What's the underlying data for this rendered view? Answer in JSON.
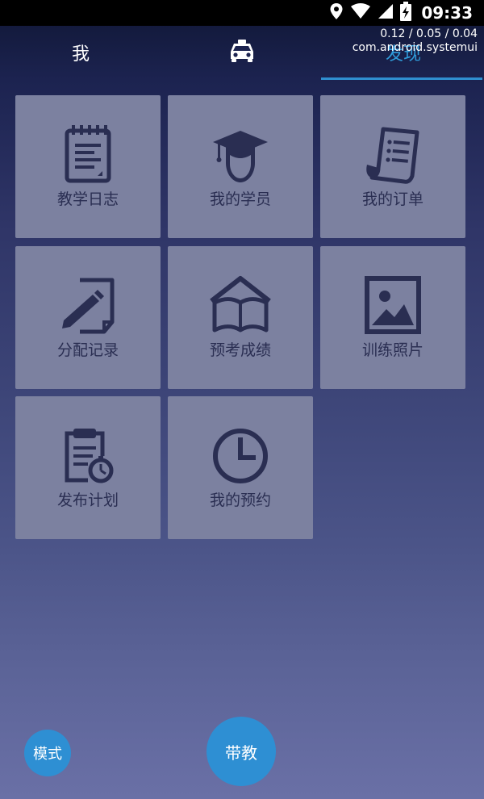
{
  "status_bar": {
    "time": "09:33"
  },
  "overlay": {
    "cpu_load": "0.12 / 0.05 / 0.04",
    "process": "com.android.systemui"
  },
  "tabs": [
    {
      "label": "我",
      "active": false
    },
    {
      "icon": "taxi-icon",
      "active": false
    },
    {
      "label": "发现",
      "active": true
    }
  ],
  "tiles": [
    {
      "label": "教学日志",
      "icon": "notebook-icon"
    },
    {
      "label": "我的学员",
      "icon": "graduate-icon"
    },
    {
      "label": "我的订单",
      "icon": "receipt-icon"
    },
    {
      "label": "分配记录",
      "icon": "pencil-note-icon"
    },
    {
      "label": "预考成绩",
      "icon": "open-book-icon"
    },
    {
      "label": "训练照片",
      "icon": "picture-icon"
    },
    {
      "label": "发布计划",
      "icon": "clipboard-timer-icon"
    },
    {
      "label": "我的预约",
      "icon": "clock-icon"
    }
  ],
  "fabs": {
    "mode_label": "模式",
    "teach_label": "带教"
  },
  "colors": {
    "accent": "#2e8fd3",
    "tile": "#7c81a0",
    "icon": "#2a2e52"
  }
}
